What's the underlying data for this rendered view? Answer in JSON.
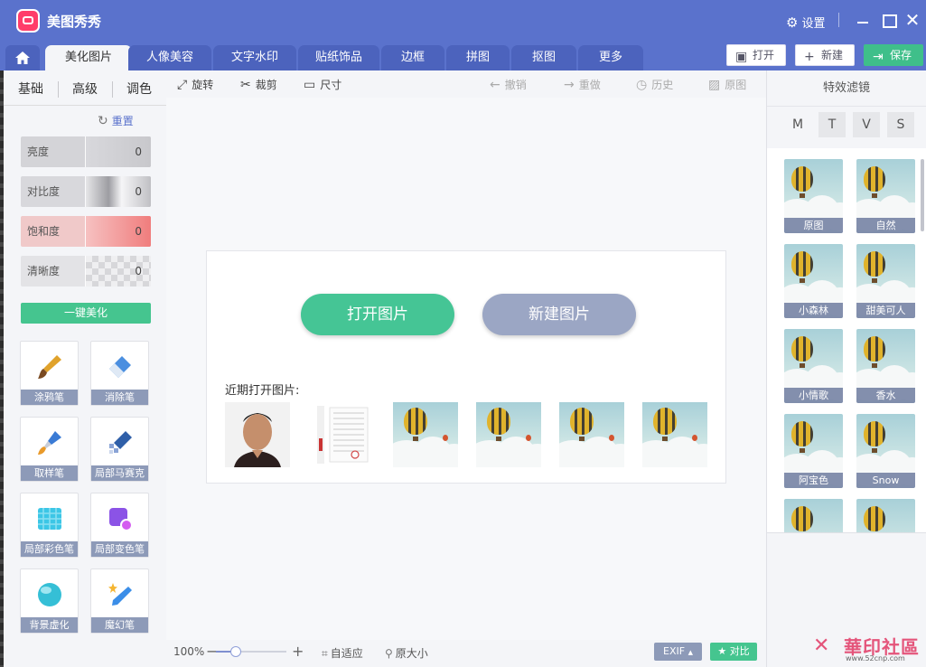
{
  "app": {
    "title": "美图秀秀",
    "settings_label": "设置"
  },
  "nav": {
    "tabs": [
      "美化图片",
      "人像美容",
      "文字水印",
      "贴纸饰品",
      "边框",
      "拼图",
      "抠图",
      "更多"
    ],
    "open_label": "打开",
    "new_label": "新建",
    "save_label": "保存"
  },
  "left": {
    "subtabs": [
      "基础",
      "高级",
      "调色"
    ],
    "reset_label": "重置",
    "sliders": [
      {
        "label": "亮度",
        "value": "0"
      },
      {
        "label": "对比度",
        "value": "0"
      },
      {
        "label": "饱和度",
        "value": "0"
      },
      {
        "label": "清晰度",
        "value": "0"
      }
    ],
    "one_click_label": "一键美化",
    "tools": [
      "涂鸦笔",
      "消除笔",
      "取样笔",
      "局部马赛克",
      "局部彩色笔",
      "局部变色笔",
      "背景虚化",
      "魔幻笔"
    ]
  },
  "toolbar": {
    "rotate": "旋转",
    "crop": "裁剪",
    "size": "尺寸",
    "undo": "撤销",
    "redo": "重做",
    "history": "历史",
    "original": "原图"
  },
  "canvas": {
    "open_image_label": "打开图片",
    "new_image_label": "新建图片",
    "recent_label": "近期打开图片:"
  },
  "bottom": {
    "zoom_level": "100%",
    "fit_label": "自适应",
    "actual_label": "原大小",
    "exif_label": "EXIF",
    "compare_label": "对比"
  },
  "right": {
    "header": "特效滤镜",
    "filter_tabs": [
      "M",
      "T",
      "V",
      "S"
    ],
    "filters": [
      "原图",
      "自然",
      "小森林",
      "甜美可人",
      "小情歌",
      "香水",
      "阿宝色",
      "Snow"
    ]
  },
  "watermark": {
    "text": "華印社區",
    "url": "www.52cnp.com"
  },
  "colors": {
    "accent": "#5a72cc",
    "green": "#45c58f",
    "brand_red": "#ff3d6a"
  }
}
